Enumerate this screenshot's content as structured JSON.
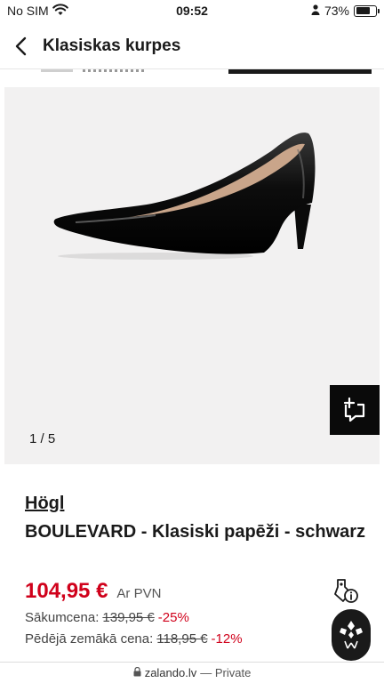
{
  "status_bar": {
    "carrier": "No SIM",
    "time": "09:52",
    "battery": "73%",
    "battery_level": 0.73
  },
  "nav": {
    "title": "Klasiskas kurpes",
    "back_icon": "chevron-left-icon"
  },
  "gallery": {
    "counter": "1 / 5",
    "current": 1,
    "total": 5,
    "add_icon": "add-to-board-icon"
  },
  "product": {
    "brand": "Högl",
    "name": "BOULEVARD - Klasiski papēži - schwarz",
    "price": "104,95 €",
    "vat_note": "Ar PVN",
    "original_price_label": "Sākumcena:",
    "original_price": "139,95 €",
    "original_discount": "-25%",
    "lowest_price_label": "Pēdējā zemākā cena:",
    "lowest_price": "118,95 €",
    "lowest_discount": "-12%",
    "info_icon": "price-tag-info-icon"
  },
  "colors": {
    "price_red": "#d0011b",
    "dark": "#1a1a1a",
    "image_bg": "#f2f1f1"
  },
  "browser": {
    "domain": "zalando.lv",
    "mode": "— Private"
  }
}
